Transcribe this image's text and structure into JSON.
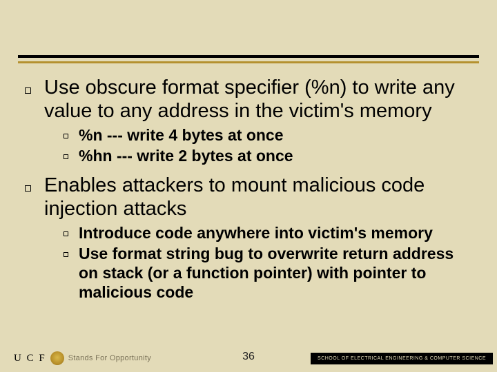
{
  "page_number": "36",
  "bullets": {
    "b1": "Use obscure format specifier (%n) to write any value to any address in the victim's memory",
    "b1_sub": [
      "%n --- write 4 bytes at once",
      "%hn  --- write 2 bytes at once"
    ],
    "b2": "Enables attackers to mount malicious code injection attacks",
    "b2_sub": [
      "Introduce code anywhere into victim's memory",
      "Use format string bug to overwrite return address on stack (or a function pointer) with pointer to malicious code"
    ]
  },
  "footer": {
    "ucf": "U C F",
    "tagline": "Stands For Opportunity",
    "school": "SCHOOL OF ELECTRICAL ENGINEERING & COMPUTER SCIENCE"
  }
}
